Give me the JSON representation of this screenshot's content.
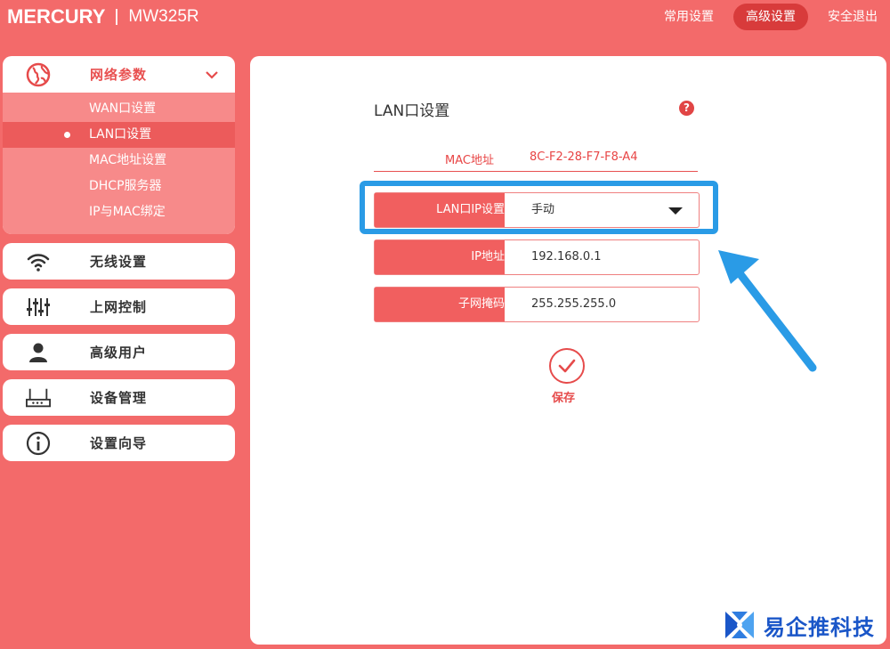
{
  "header": {
    "brand": "MERCURY",
    "model": "MW325R",
    "nav": [
      {
        "label": "常用设置",
        "active": false
      },
      {
        "label": "高级设置",
        "active": true
      },
      {
        "label": "安全退出",
        "active": false
      }
    ]
  },
  "sidebar": {
    "network": {
      "label": "网络参数",
      "icon": "globe-icon",
      "expanded": true,
      "items": [
        {
          "label": "WAN口设置"
        },
        {
          "label": "LAN口设置"
        },
        {
          "label": "MAC地址设置"
        },
        {
          "label": "DHCP服务器"
        },
        {
          "label": "IP与MAC绑定"
        }
      ]
    },
    "menus": [
      {
        "label": "无线设置",
        "icon": "wifi-icon"
      },
      {
        "label": "上网控制",
        "icon": "sliders-icon"
      },
      {
        "label": "高级用户",
        "icon": "user-icon"
      },
      {
        "label": "设备管理",
        "icon": "router-icon"
      },
      {
        "label": "设置向导",
        "icon": "info-icon"
      }
    ]
  },
  "main": {
    "title": "LAN口设置",
    "help": "?",
    "mac": {
      "label": "MAC地址",
      "value": "8C-F2-28-F7-F8-A4"
    },
    "lan_ip_mode": {
      "label": "LAN口IP设置",
      "value": "手动"
    },
    "ip": {
      "label": "IP地址",
      "value": "192.168.0.1"
    },
    "mask": {
      "label": "子网掩码",
      "value": "255.255.255.0"
    },
    "save_label": "保存"
  },
  "watermark": {
    "text": "易企推科技"
  },
  "colors": {
    "background": "#f36a6a",
    "accent": "#e64b4b",
    "highlight": "#2a9be6"
  }
}
